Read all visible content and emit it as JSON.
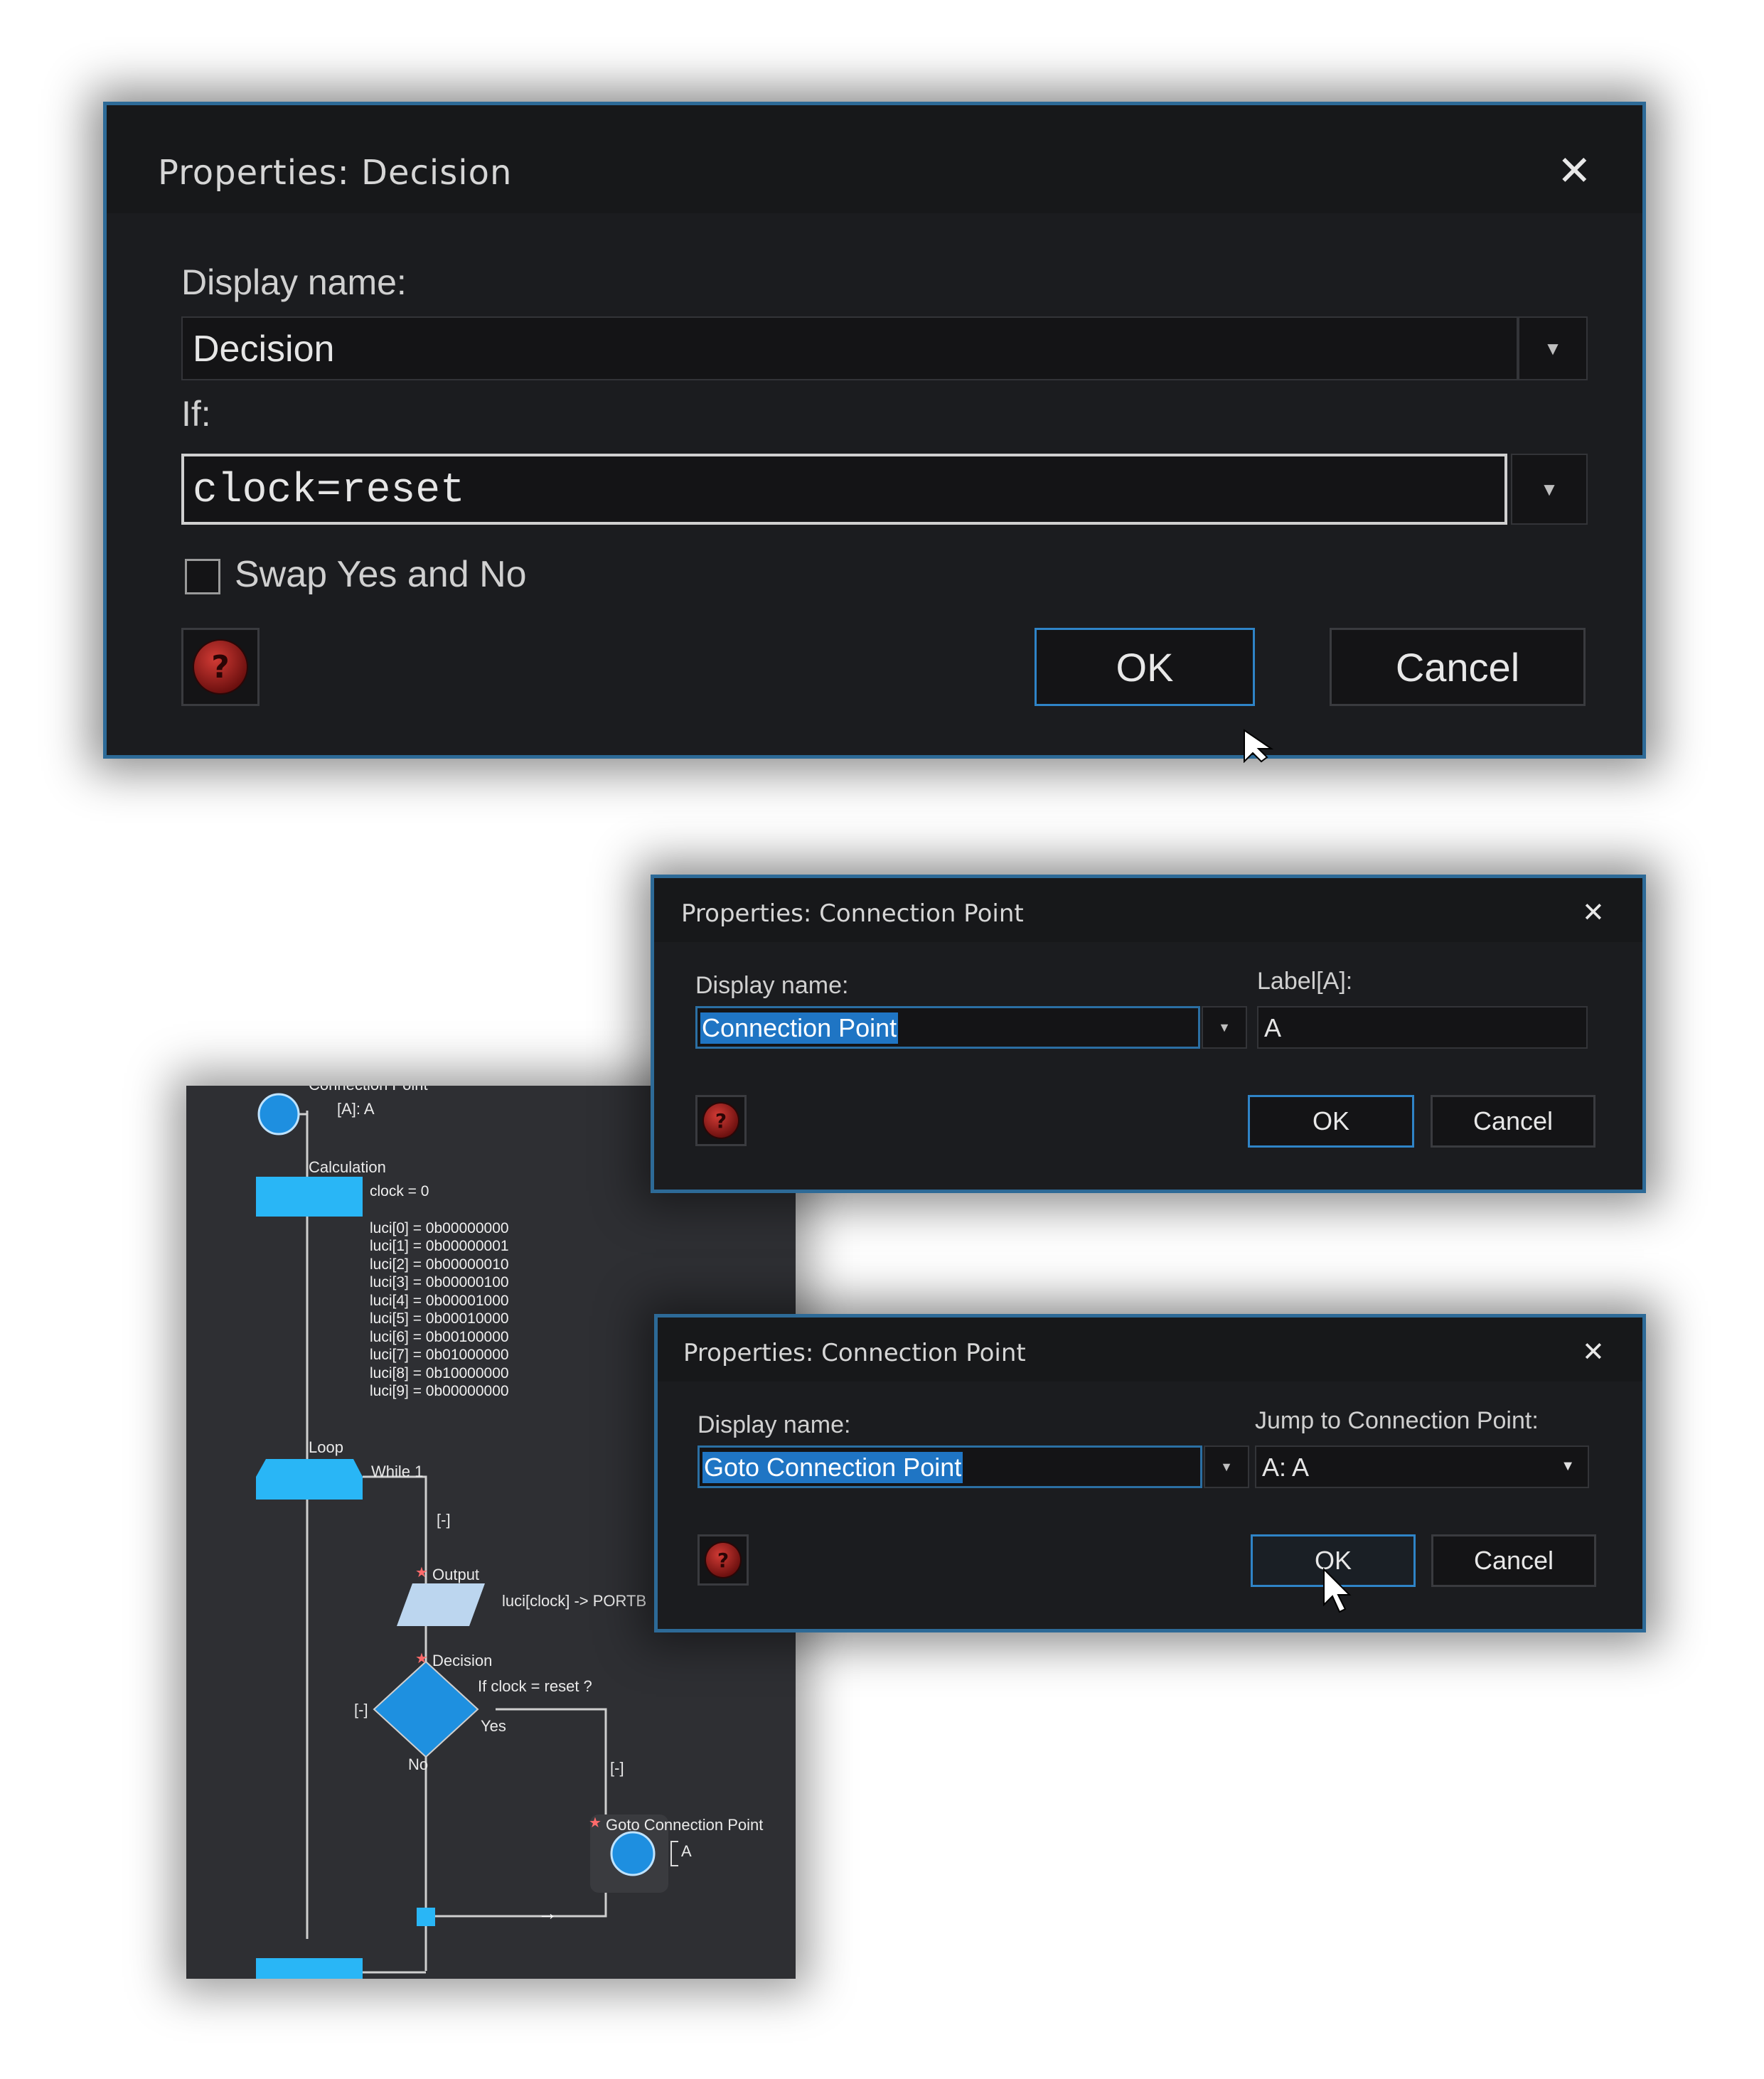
{
  "colors": {
    "dialog_bg": "#1b1c1f",
    "dialog_border": "#2d6a97",
    "accent": "#2f84c7",
    "selection": "#1f75c4",
    "flow_shape": "#29b6f6",
    "flow_bg": "#2e2f33"
  },
  "decision_dialog": {
    "title": "Properties: Decision",
    "close_icon": "close-icon",
    "display_name_label": "Display name:",
    "display_name_value": "Decision",
    "if_label": "If:",
    "if_value": "clock=reset",
    "swap_label": "Swap Yes and No",
    "swap_checked": false,
    "help_icon": "help-icon",
    "ok_label": "OK",
    "cancel_label": "Cancel"
  },
  "connection_dialog": {
    "title": "Properties: Connection Point",
    "display_name_label": "Display name:",
    "display_name_value": "Connection Point",
    "label_label": "Label[A]:",
    "label_value": "A",
    "ok_label": "OK",
    "cancel_label": "Cancel"
  },
  "goto_dialog": {
    "title": "Properties: Connection Point",
    "display_name_label": "Display name:",
    "display_name_value": "Goto Connection Point",
    "jump_label": "Jump to Connection Point:",
    "jump_value": "A: A",
    "ok_label": "OK",
    "cancel_label": "Cancel"
  },
  "flowchart": {
    "top_cut_label": "Connection Point",
    "conn_label": "[A]: A",
    "calc_title": "Calculation",
    "calc_lines": [
      "clock = 0",
      "luci[0] = 0b00000000",
      "luci[1] = 0b00000001",
      "luci[2] = 0b00000010",
      "luci[3] = 0b00000100",
      "luci[4] = 0b00001000",
      "luci[5] = 0b00010000",
      "luci[6] = 0b00100000",
      "luci[7] = 0b01000000",
      "luci[8] = 0b10000000",
      "luci[9] = 0b00000000"
    ],
    "loop_title": "Loop",
    "loop_cond": "While 1",
    "collapse_1": "[-]",
    "output_title": "Output",
    "output_text": "luci[clock] -> PORTB",
    "decision_title": "Decision",
    "decision_cond": "If clock = reset ?",
    "decision_collapse": "[-]",
    "yes_label": "Yes",
    "no_label": "No",
    "yes_collapse": "[-]",
    "goto_title": "Goto Connection Point",
    "goto_label": "A",
    "flow_arrow": "→",
    "star": "★"
  }
}
